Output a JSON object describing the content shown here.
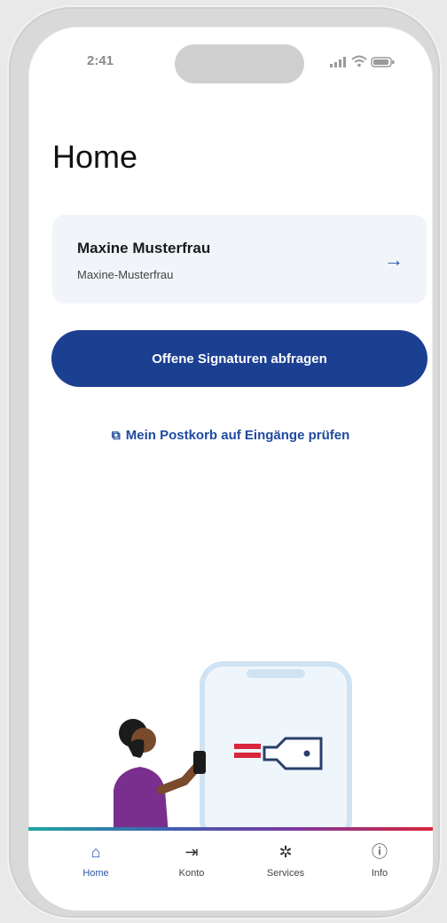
{
  "status_bar": {
    "time": "2:41"
  },
  "page": {
    "title": "Home"
  },
  "account": {
    "name": "Maxine Musterfrau",
    "username": "Maxine-Musterfrau",
    "arrow": "→"
  },
  "actions": {
    "primary_label": "Offene Signaturen abfragen",
    "link_label": "Mein Postkorb auf Eingänge prüfen"
  },
  "tabs": [
    {
      "label": "Home",
      "icon": "home-icon",
      "active": true
    },
    {
      "label": "Konto",
      "icon": "account-icon",
      "active": false
    },
    {
      "label": "Services",
      "icon": "services-icon",
      "active": false
    },
    {
      "label": "Info",
      "icon": "info-icon",
      "active": false
    }
  ],
  "colors": {
    "primary": "#1b3f91",
    "link": "#1f4aa0",
    "card_bg": "#f1f4f8",
    "accent_red": "#d8263a",
    "accent_teal": "#1fa6a0"
  }
}
